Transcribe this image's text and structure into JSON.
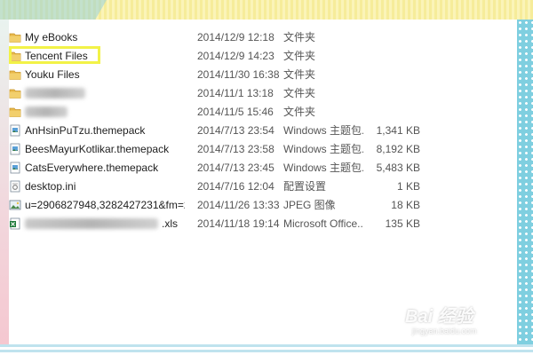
{
  "files": [
    {
      "icon": "folder-icon",
      "name": "My eBooks",
      "date": "2014/12/9 12:18",
      "type": "文件夹",
      "size": ""
    },
    {
      "icon": "folder-icon",
      "name": "Tencent Files",
      "date": "2014/12/9 14:23",
      "type": "文件夹",
      "size": ""
    },
    {
      "icon": "folder-icon",
      "name": "Youku Files",
      "date": "2014/11/30 16:38",
      "type": "文件夹",
      "size": ""
    },
    {
      "icon": "folder-icon",
      "name": "",
      "date": "2014/11/1 13:18",
      "type": "文件夹",
      "size": ""
    },
    {
      "icon": "folder-icon",
      "name": "",
      "date": "2014/11/5 15:46",
      "type": "文件夹",
      "size": ""
    },
    {
      "icon": "themepack-icon",
      "name": "AnHsinPuTzu.themepack",
      "date": "2014/7/13 23:54",
      "type": "Windows 主题包...",
      "size": "1,341 KB"
    },
    {
      "icon": "themepack-icon",
      "name": "BeesMayurKotlikar.themepack",
      "date": "2014/7/13 23:58",
      "type": "Windows 主题包...",
      "size": "8,192 KB"
    },
    {
      "icon": "themepack-icon",
      "name": "CatsEverywhere.themepack",
      "date": "2014/7/13 23:45",
      "type": "Windows 主题包...",
      "size": "5,483 KB"
    },
    {
      "icon": "config-file-icon",
      "name": "desktop.ini",
      "date": "2014/7/16 12:04",
      "type": "配置设置",
      "size": "1 KB"
    },
    {
      "icon": "jpeg-image-icon",
      "name": "u=2906827948,3282427231&fm=21&...",
      "date": "2014/11/26 13:33",
      "type": "JPEG 图像",
      "size": "18 KB"
    },
    {
      "icon": "excel-file-icon",
      "name": ".xls",
      "date": "2014/11/18 19:14",
      "type": "Microsoft Office...",
      "size": "135 KB"
    }
  ],
  "watermark": {
    "logo": "Bai 经验",
    "url": "jingyan.baidu.com"
  },
  "colors": {
    "highlight": "#f2f247",
    "folder": "#e8b84a",
    "accent_right_band": "#7fcfe0"
  }
}
